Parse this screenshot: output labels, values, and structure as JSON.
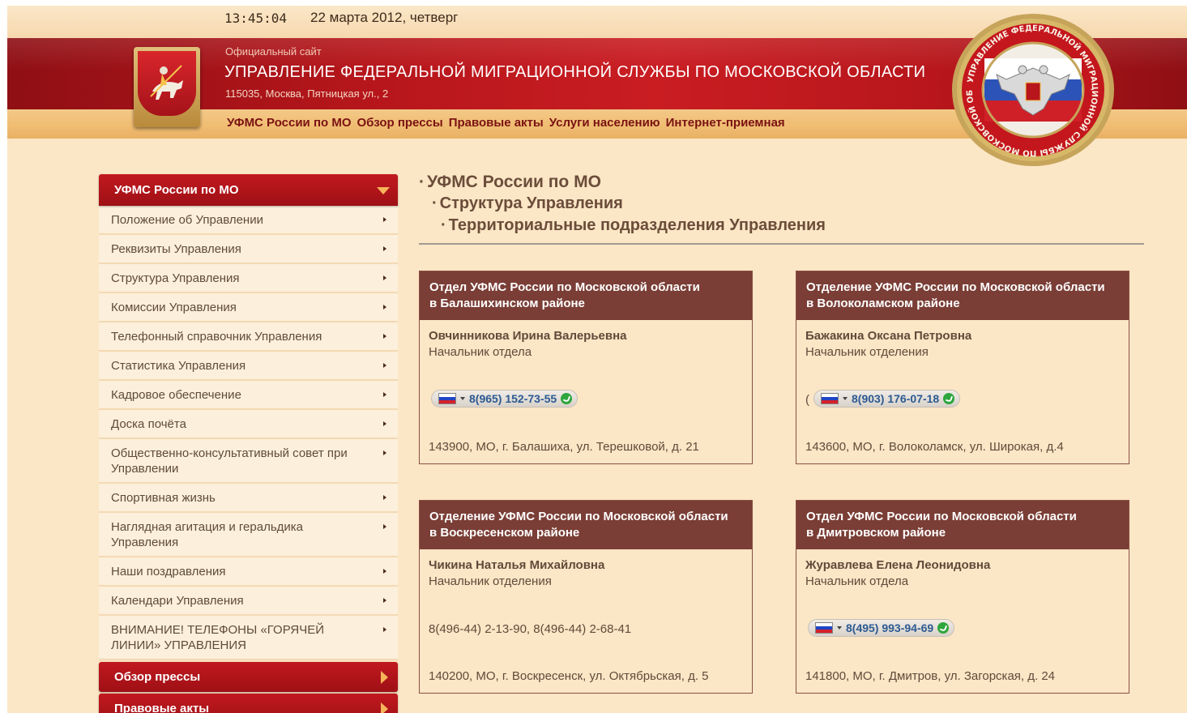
{
  "header": {
    "time": "13:45:04",
    "date": "22 марта 2012, четверг",
    "kicker": "Официальный сайт",
    "title": "УПРАВЛЕНИЕ ФЕДЕРАЛЬНОЙ МИГРАЦИОННОЙ СЛУЖБЫ ПО МОСКОВСКОЙ ОБЛАСТИ",
    "address": "115035, Москва, Пятницкая ул., 2",
    "emblem_text": "УПРАВЛЕНИЕ ФЕДЕРАЛЬНОЙ МИГРАЦИОННОЙ СЛУЖБЫ ПО МОСКОВСКОЙ ОБЛАСТИ"
  },
  "nav": [
    "УФМС России по МО",
    "Обзор прессы",
    "Правовые акты",
    "Услуги населению",
    "Интернет-приемная"
  ],
  "sidebar": {
    "header": "УФМС России по МО",
    "items": [
      "Положение об Управлении",
      "Реквизиты Управления",
      "Структура Управления",
      "Комиссии Управления",
      "Телефонный справочник Управления",
      "Статистика Управления",
      "Кадровое обеспечение",
      "Доска почёта",
      "Общественно-консультативный совет при Управлении",
      "Спортивная жизнь",
      "Наглядная агитация и геральдика Управления",
      "Наши поздравления",
      "Календари Управления",
      "ВНИМАНИЕ! ТЕЛЕФОНЫ «ГОРЯЧЕЙ ЛИНИИ» УПРАВЛЕНИЯ"
    ],
    "sections": [
      "Обзор прессы",
      "Правовые акты"
    ]
  },
  "breadcrumbs": [
    "УФМС России по МО",
    "Структура Управления",
    "Территориальные подразделения Управления"
  ],
  "cards": [
    {
      "title_line1": "Отдел УФМС России по Московской области",
      "title_line2": "в Балашихинском районе",
      "name": "Овчинникова Ирина Валерьевна",
      "role": "Начальник отдела",
      "phone": "8(965) 152-73-55",
      "address": "143900, МО, г. Балашиха, ул. Терешковой, д. 21"
    },
    {
      "title_line1": "Отделение УФМС России по Московской области",
      "title_line2": "в Волоколамском районе",
      "name": "Бажакина Оксана Петровна",
      "role": "Начальник отделения",
      "phone_prefix": "(",
      "phone": "8(903) 176-07-18",
      "address": "143600, МО, г. Волоколамск, ул. Широкая, д.4"
    },
    {
      "title_line1": "Отделение УФМС России по Московской области",
      "title_line2": "в Воскресенском районе",
      "name": "Чикина Наталья Михайловна",
      "role": "Начальник отделения",
      "phone": "8(496-44) 2-13-90, 8(496-44) 2-68-41",
      "address": "140200, МО, г. Воскресенск, ул. Октябрьская, д. 5"
    },
    {
      "title_line1": "Отдел УФМС России по Московской области",
      "title_line2": "в Дмитровском районе",
      "name": "Журавлева Елена Леонидовна",
      "role": "Начальник отдела",
      "phone": "8(495) 993-94-69",
      "address": "141800, МО, г. Дмитров, ул. Загорская, д. 24"
    }
  ],
  "colors": {
    "banner": "#c91d22",
    "nav_strip": "#f0bd73",
    "card_head": "#7a3e36",
    "page_bg": "#fbe6c6"
  },
  "icons": [
    "coat-of-arms-icon",
    "fms-emblem-icon",
    "flag-ru-icon",
    "call-icon"
  ]
}
